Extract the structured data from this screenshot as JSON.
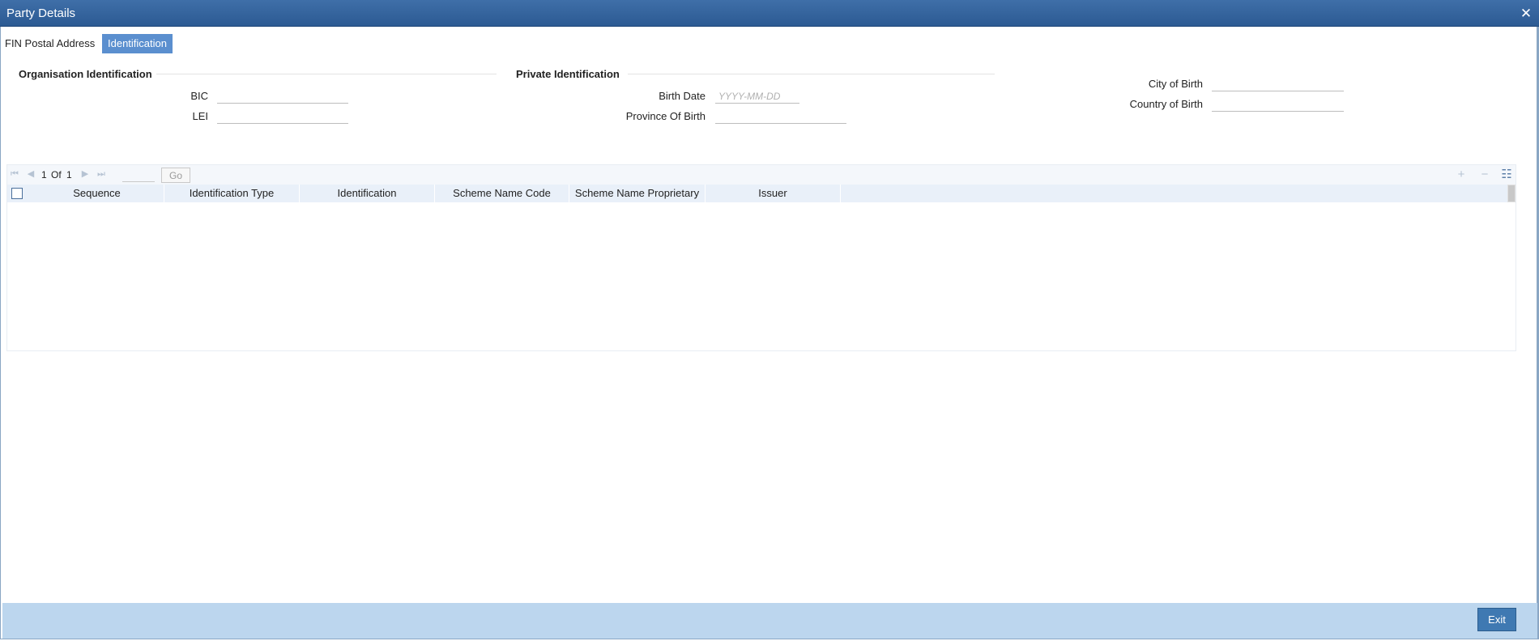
{
  "window": {
    "title": "Party Details",
    "close_symbol": "✕"
  },
  "tabs": [
    {
      "label": "FIN Postal Address",
      "active": false
    },
    {
      "label": "Identification",
      "active": true
    }
  ],
  "organisation": {
    "title": "Organisation Identification",
    "bic_label": "BIC",
    "bic_value": "",
    "lei_label": "LEI",
    "lei_value": ""
  },
  "private": {
    "title": "Private Identification",
    "birth_date_label": "Birth Date",
    "birth_date_placeholder": "YYYY-MM-DD",
    "province_label": "Province Of Birth",
    "province_value": ""
  },
  "birth": {
    "city_label": "City of Birth",
    "city_value": "",
    "country_label": "Country of Birth",
    "country_value": ""
  },
  "pager": {
    "current": "1",
    "of_label": "Of",
    "total": "1",
    "go_label": "Go"
  },
  "grid": {
    "columns": [
      "Sequence",
      "Identification Type",
      "Identification",
      "Scheme Name Code",
      "Scheme Name Proprietary",
      "Issuer"
    ],
    "rows": []
  },
  "footer": {
    "exit_label": "Exit"
  }
}
